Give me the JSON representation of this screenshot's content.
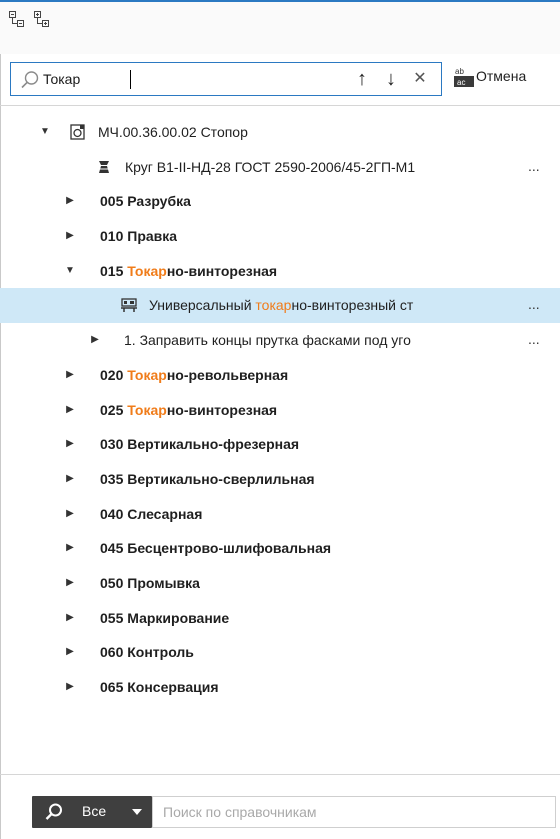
{
  "toolbar": {
    "icons": [
      "tree-collapse-icon",
      "tree-expand-icon"
    ]
  },
  "search": {
    "value": "Токар",
    "prev_glyph": "↑",
    "next_glyph": "↓",
    "clear_glyph": "✕",
    "cancel_label": "Отмена"
  },
  "tree": {
    "root": {
      "label": "МЧ.00.36.00.02 Стопор",
      "icon": "part-doc-icon"
    },
    "material": {
      "label": "Круг В1-II-НД-28 ГОСТ 2590-2006/45-2ГП-М1",
      "icon": "material-icon",
      "more": "..."
    },
    "ops": [
      {
        "num": "005",
        "pre": "Разрубка",
        "hl": "",
        "post": ""
      },
      {
        "num": "010",
        "pre": "Правка",
        "hl": "",
        "post": ""
      },
      {
        "num": "015",
        "pre": "",
        "hl": "Токар",
        "post": "но-винторезная"
      },
      {
        "num": "020",
        "pre": "",
        "hl": "Токар",
        "post": "но-револьверная"
      },
      {
        "num": "025",
        "pre": "",
        "hl": "Токар",
        "post": "но-винторезная"
      },
      {
        "num": "030",
        "pre": "Вертикально-фрезерная",
        "hl": "",
        "post": ""
      },
      {
        "num": "035",
        "pre": "Вертикально-сверлильная",
        "hl": "",
        "post": ""
      },
      {
        "num": "040",
        "pre": "Слесарная",
        "hl": "",
        "post": ""
      },
      {
        "num": "045",
        "pre": "Бесцентрово-шлифовальная",
        "hl": "",
        "post": ""
      },
      {
        "num": "050",
        "pre": "Промывка",
        "hl": "",
        "post": ""
      },
      {
        "num": "055",
        "pre": "Маркирование",
        "hl": "",
        "post": ""
      },
      {
        "num": "060",
        "pre": "Контроль",
        "hl": "",
        "post": ""
      },
      {
        "num": "065",
        "pre": "Консервация",
        "hl": "",
        "post": ""
      }
    ],
    "equipment": {
      "pre": "Универсальный ",
      "hl": "токар",
      "post": "но-винторезный ст",
      "more": "...",
      "icon": "lathe-icon"
    },
    "step": {
      "label": "1. Заправить концы прутка фасками под уго",
      "more": "..."
    }
  },
  "bottom": {
    "scope_label": "Все",
    "placeholder": "Поиск по справочникам"
  },
  "colors": {
    "accent": "#2b79c2",
    "highlight": "#f07c1a",
    "selection": "#cfe8f7"
  }
}
